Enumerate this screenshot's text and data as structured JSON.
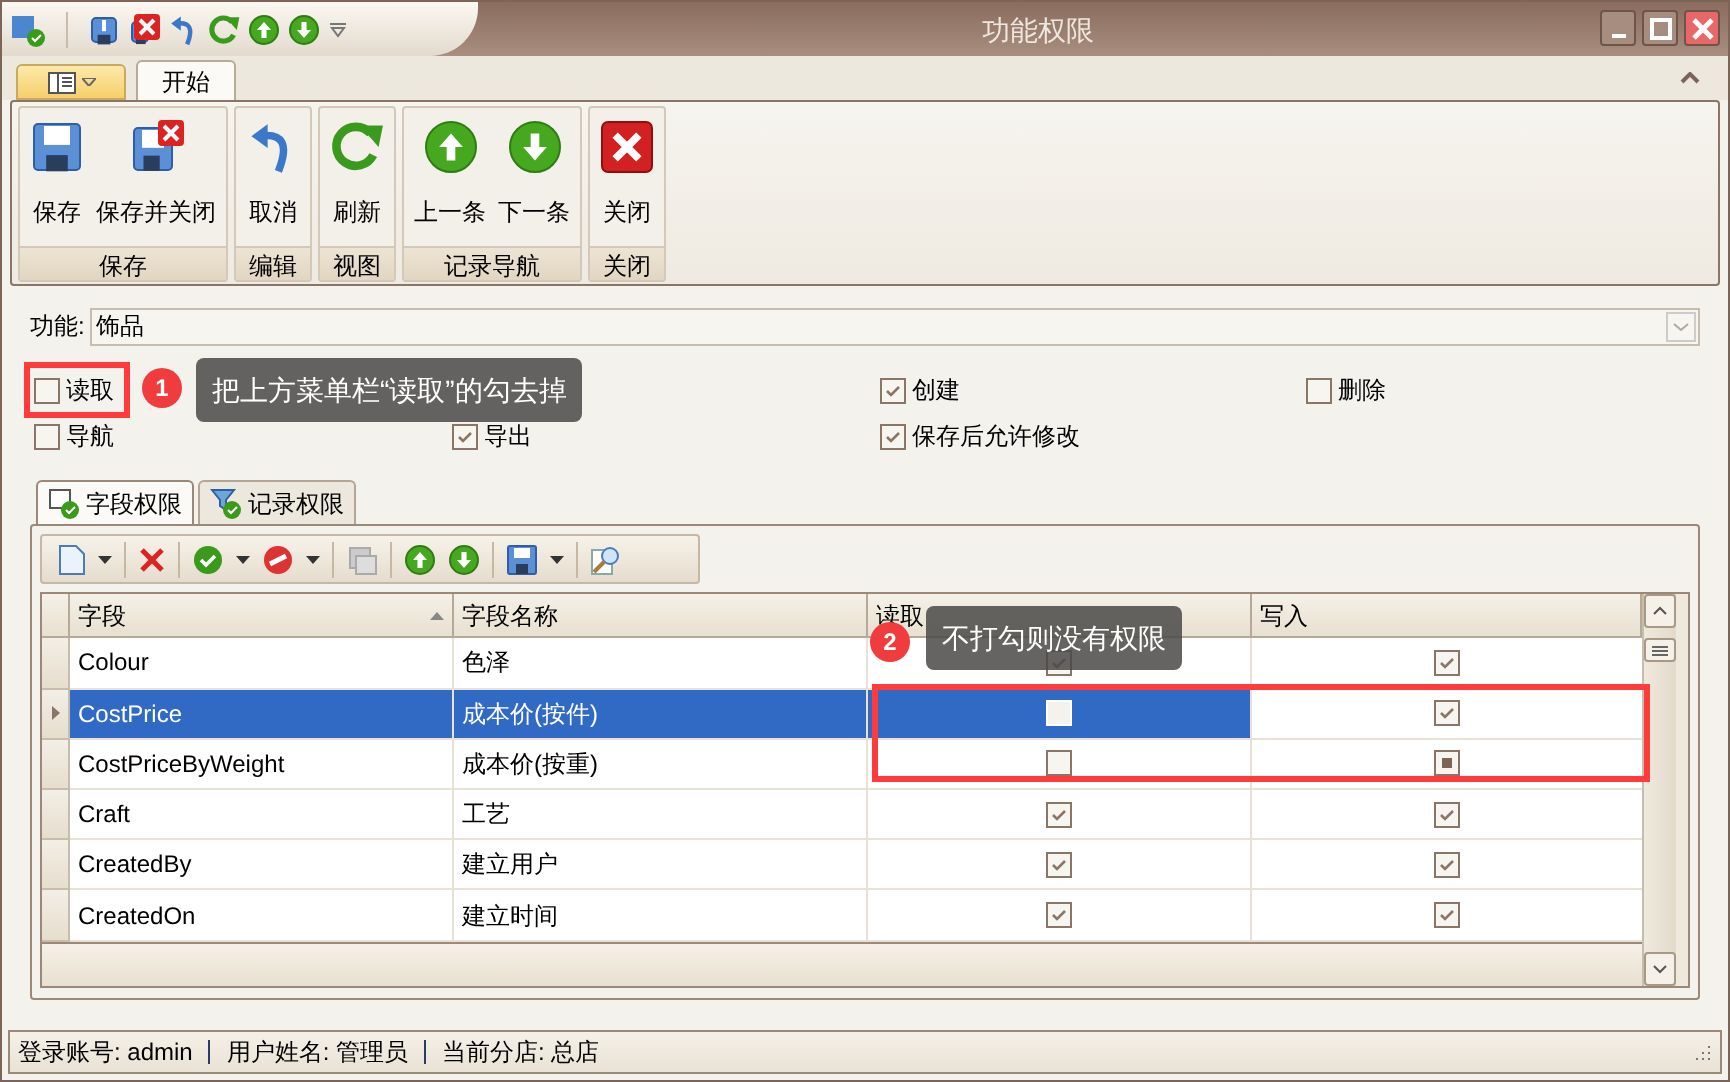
{
  "window": {
    "title": "功能权限"
  },
  "ribbon": {
    "tabs": [
      {
        "label": "开始",
        "selected": true
      }
    ],
    "groups": [
      {
        "label": "保存",
        "buttons": [
          {
            "label": "保存"
          },
          {
            "label": "保存并关闭"
          }
        ]
      },
      {
        "label": "编辑",
        "buttons": [
          {
            "label": "取消"
          }
        ]
      },
      {
        "label": "视图",
        "buttons": [
          {
            "label": "刷新"
          }
        ]
      },
      {
        "label": "记录导航",
        "buttons": [
          {
            "label": "上一条"
          },
          {
            "label": "下一条"
          }
        ]
      },
      {
        "label": "关闭",
        "buttons": [
          {
            "label": "关闭"
          }
        ]
      }
    ]
  },
  "function_field": {
    "label": "功能:",
    "value": "饰品"
  },
  "permissions": [
    {
      "label": "读取",
      "checked": false
    },
    {
      "label": "创建",
      "checked": true
    },
    {
      "label": "删除",
      "checked": false
    },
    {
      "label": "导航",
      "checked": false
    },
    {
      "label": "导出",
      "checked": true
    },
    {
      "label": "保存后允许修改",
      "checked": true
    }
  ],
  "tabs": [
    {
      "label": "字段权限",
      "selected": true
    },
    {
      "label": "记录权限",
      "selected": false
    }
  ],
  "grid": {
    "columns": [
      {
        "label": "字段",
        "sorted": true
      },
      {
        "label": "字段名称",
        "sorted": false
      },
      {
        "label": "读取",
        "sorted": false
      },
      {
        "label": "写入",
        "sorted": false
      }
    ],
    "rows": [
      {
        "field": "Colour",
        "name": "色泽",
        "read_checked": true,
        "write_checked": true,
        "selected": false
      },
      {
        "field": "CostPrice",
        "name": "成本价(按件)",
        "read_checked": false,
        "write_checked": true,
        "selected": true
      },
      {
        "field": "CostPriceByWeight",
        "name": "成本价(按重)",
        "read_checked": false,
        "write_checked": null,
        "selected": false
      },
      {
        "field": "Craft",
        "name": "工艺",
        "read_checked": true,
        "write_checked": true,
        "selected": false
      },
      {
        "field": "CreatedBy",
        "name": "建立用户",
        "read_checked": true,
        "write_checked": true,
        "selected": false
      },
      {
        "field": "CreatedOn",
        "name": "建立时间",
        "read_checked": true,
        "write_checked": true,
        "selected": false
      }
    ]
  },
  "status_bar": [
    "登录账号: admin",
    "用户姓名: 管理员",
    "当前分店: 总店"
  ],
  "annotations": [
    {
      "number": "1",
      "text": "把上方菜单栏“读取”的勾去掉"
    },
    {
      "number": "2",
      "text": "不打勾则没有权限"
    }
  ]
}
